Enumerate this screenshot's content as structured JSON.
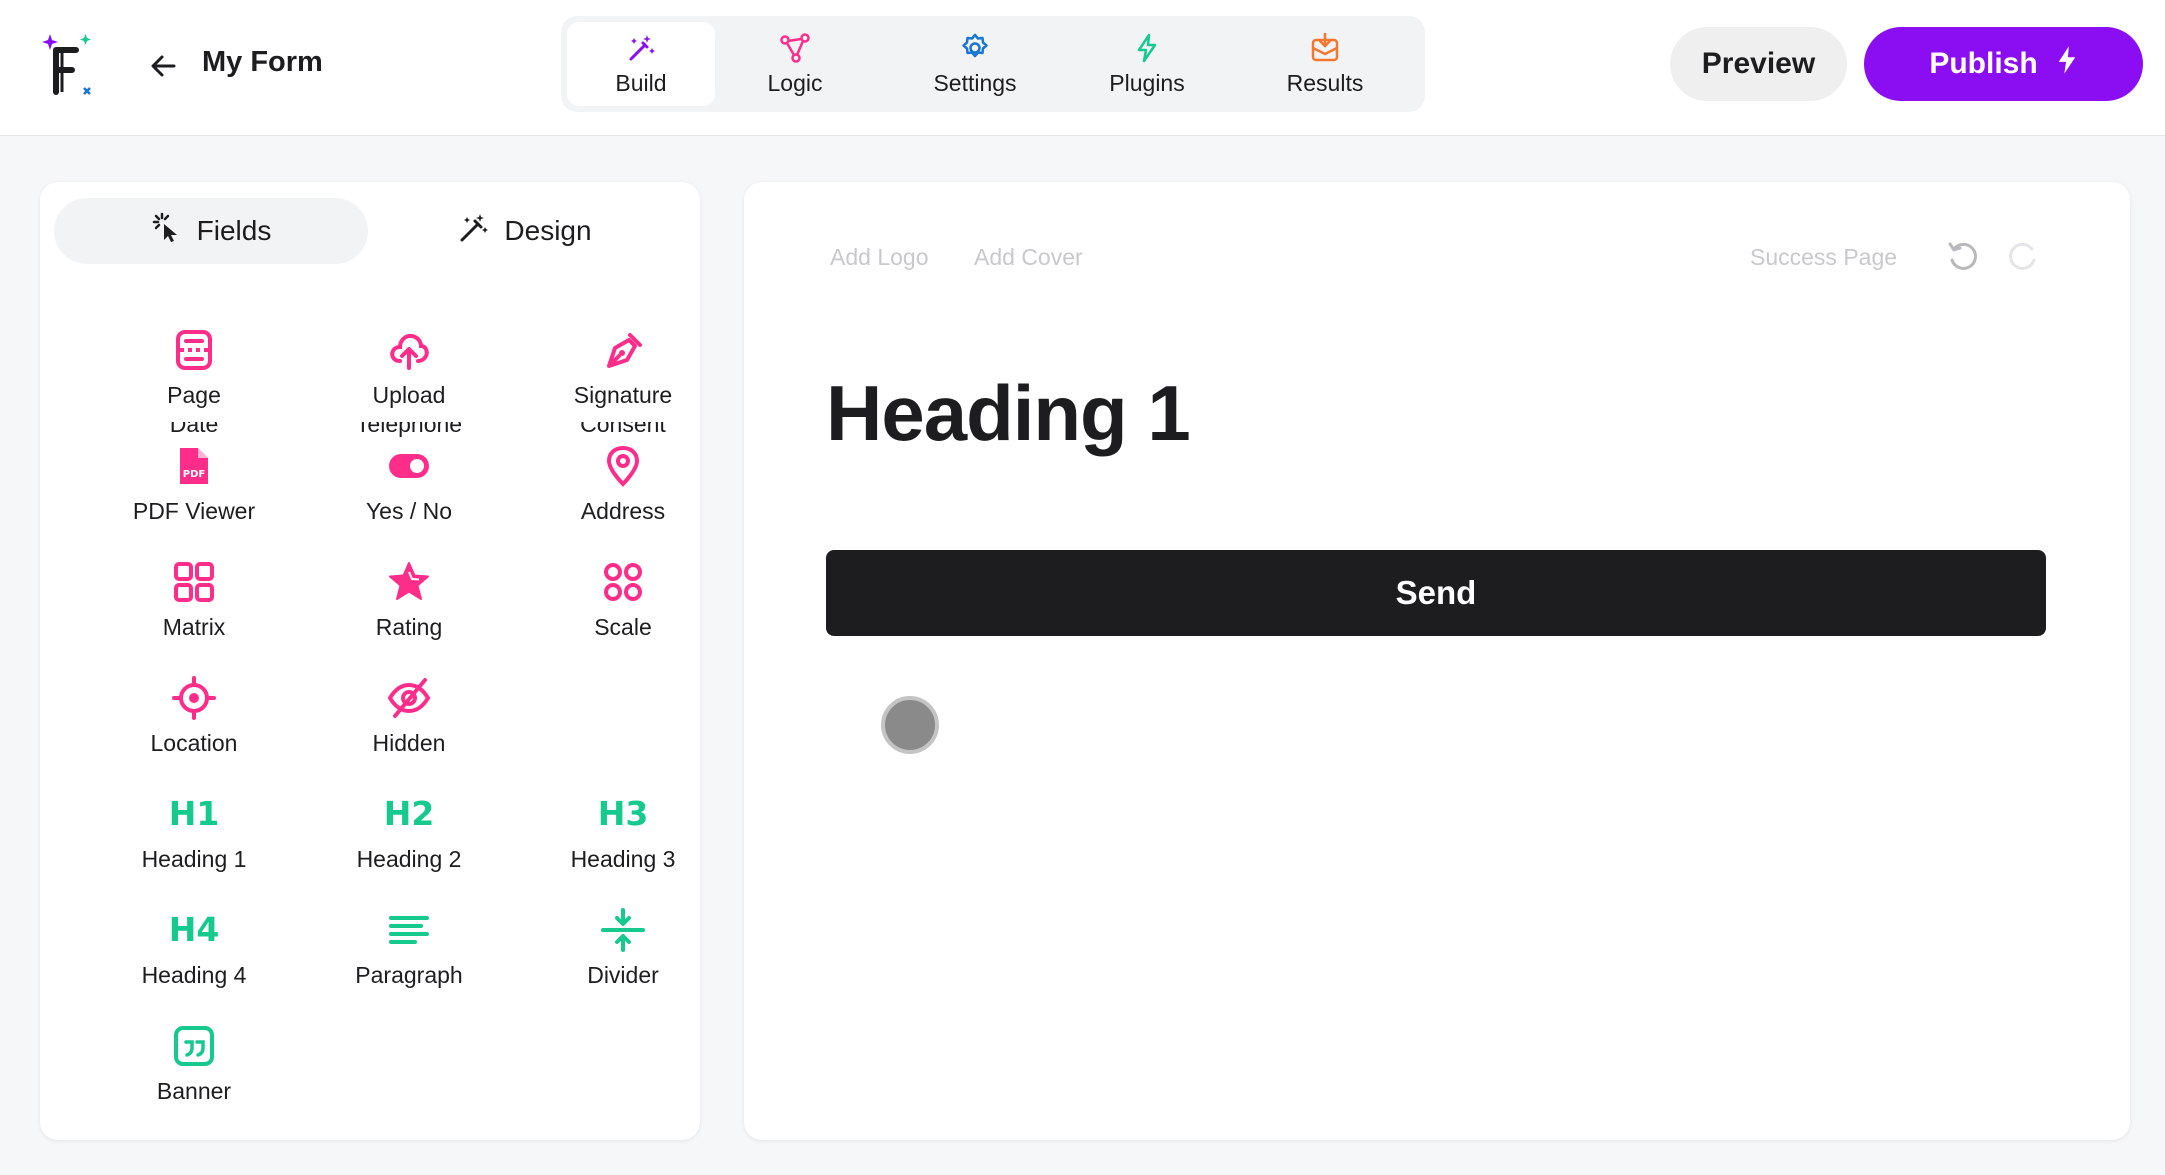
{
  "header": {
    "form_title": "My Form",
    "tabs": [
      {
        "label": "Build",
        "icon": "magic-wand-icon",
        "color": "#8b0df2",
        "active": true
      },
      {
        "label": "Logic",
        "icon": "nodes-icon",
        "color": "#ff2d8a",
        "active": false
      },
      {
        "label": "Settings",
        "icon": "gear-icon",
        "color": "#1976d2",
        "active": false
      },
      {
        "label": "Plugins",
        "icon": "lightning-icon",
        "color": "#16c98d",
        "active": false
      },
      {
        "label": "Results",
        "icon": "inbox-icon",
        "color": "#f5772d",
        "active": false
      }
    ],
    "preview_label": "Preview",
    "publish_label": "Publish",
    "publish_color": "#8b0df2"
  },
  "panel": {
    "tabs": [
      {
        "label": "Fields",
        "icon": "pointer-click-icon",
        "active": true
      },
      {
        "label": "Design",
        "icon": "magic-wand-icon",
        "active": false
      }
    ],
    "clipped_row": [
      "Date",
      "Telephone",
      "Consent"
    ],
    "fields": [
      {
        "label": "Page",
        "icon": "page-icon",
        "color": "#ff2d8a"
      },
      {
        "label": "Upload",
        "icon": "cloud-upload-icon",
        "color": "#ff2d8a"
      },
      {
        "label": "Signature",
        "icon": "pen-nib-icon",
        "color": "#ff2d8a"
      },
      {
        "label": "PDF Viewer",
        "icon": "pdf-icon",
        "color": "#ff2d8a"
      },
      {
        "label": "Yes / No",
        "icon": "toggle-icon",
        "color": "#ff2d8a"
      },
      {
        "label": "Address",
        "icon": "map-pin-icon",
        "color": "#ff2d8a"
      },
      {
        "label": "Matrix",
        "icon": "grid-icon",
        "color": "#ff2d8a"
      },
      {
        "label": "Rating",
        "icon": "star-icon",
        "color": "#ff2d8a"
      },
      {
        "label": "Scale",
        "icon": "four-circles-icon",
        "color": "#ff2d8a"
      },
      {
        "label": "Location",
        "icon": "target-icon",
        "color": "#ff2d8a"
      },
      {
        "label": "Hidden",
        "icon": "eye-off-icon",
        "color": "#ff2d8a"
      },
      {
        "label": "Heading 1",
        "glyph": "H1",
        "color": "#16c98d"
      },
      {
        "label": "Heading 2",
        "glyph": "H2",
        "color": "#16c98d"
      },
      {
        "label": "Heading 3",
        "glyph": "H3",
        "color": "#16c98d"
      },
      {
        "label": "Heading 4",
        "glyph": "H4",
        "color": "#16c98d"
      },
      {
        "label": "Paragraph",
        "icon": "paragraph-icon",
        "color": "#16c98d"
      },
      {
        "label": "Divider",
        "icon": "divider-icon",
        "color": "#16c98d"
      },
      {
        "label": "Banner",
        "icon": "quote-icon",
        "color": "#16c98d"
      }
    ]
  },
  "canvas": {
    "add_logo": "Add Logo",
    "add_cover": "Add Cover",
    "success_page": "Success Page",
    "heading": "Heading 1",
    "send_label": "Send"
  }
}
